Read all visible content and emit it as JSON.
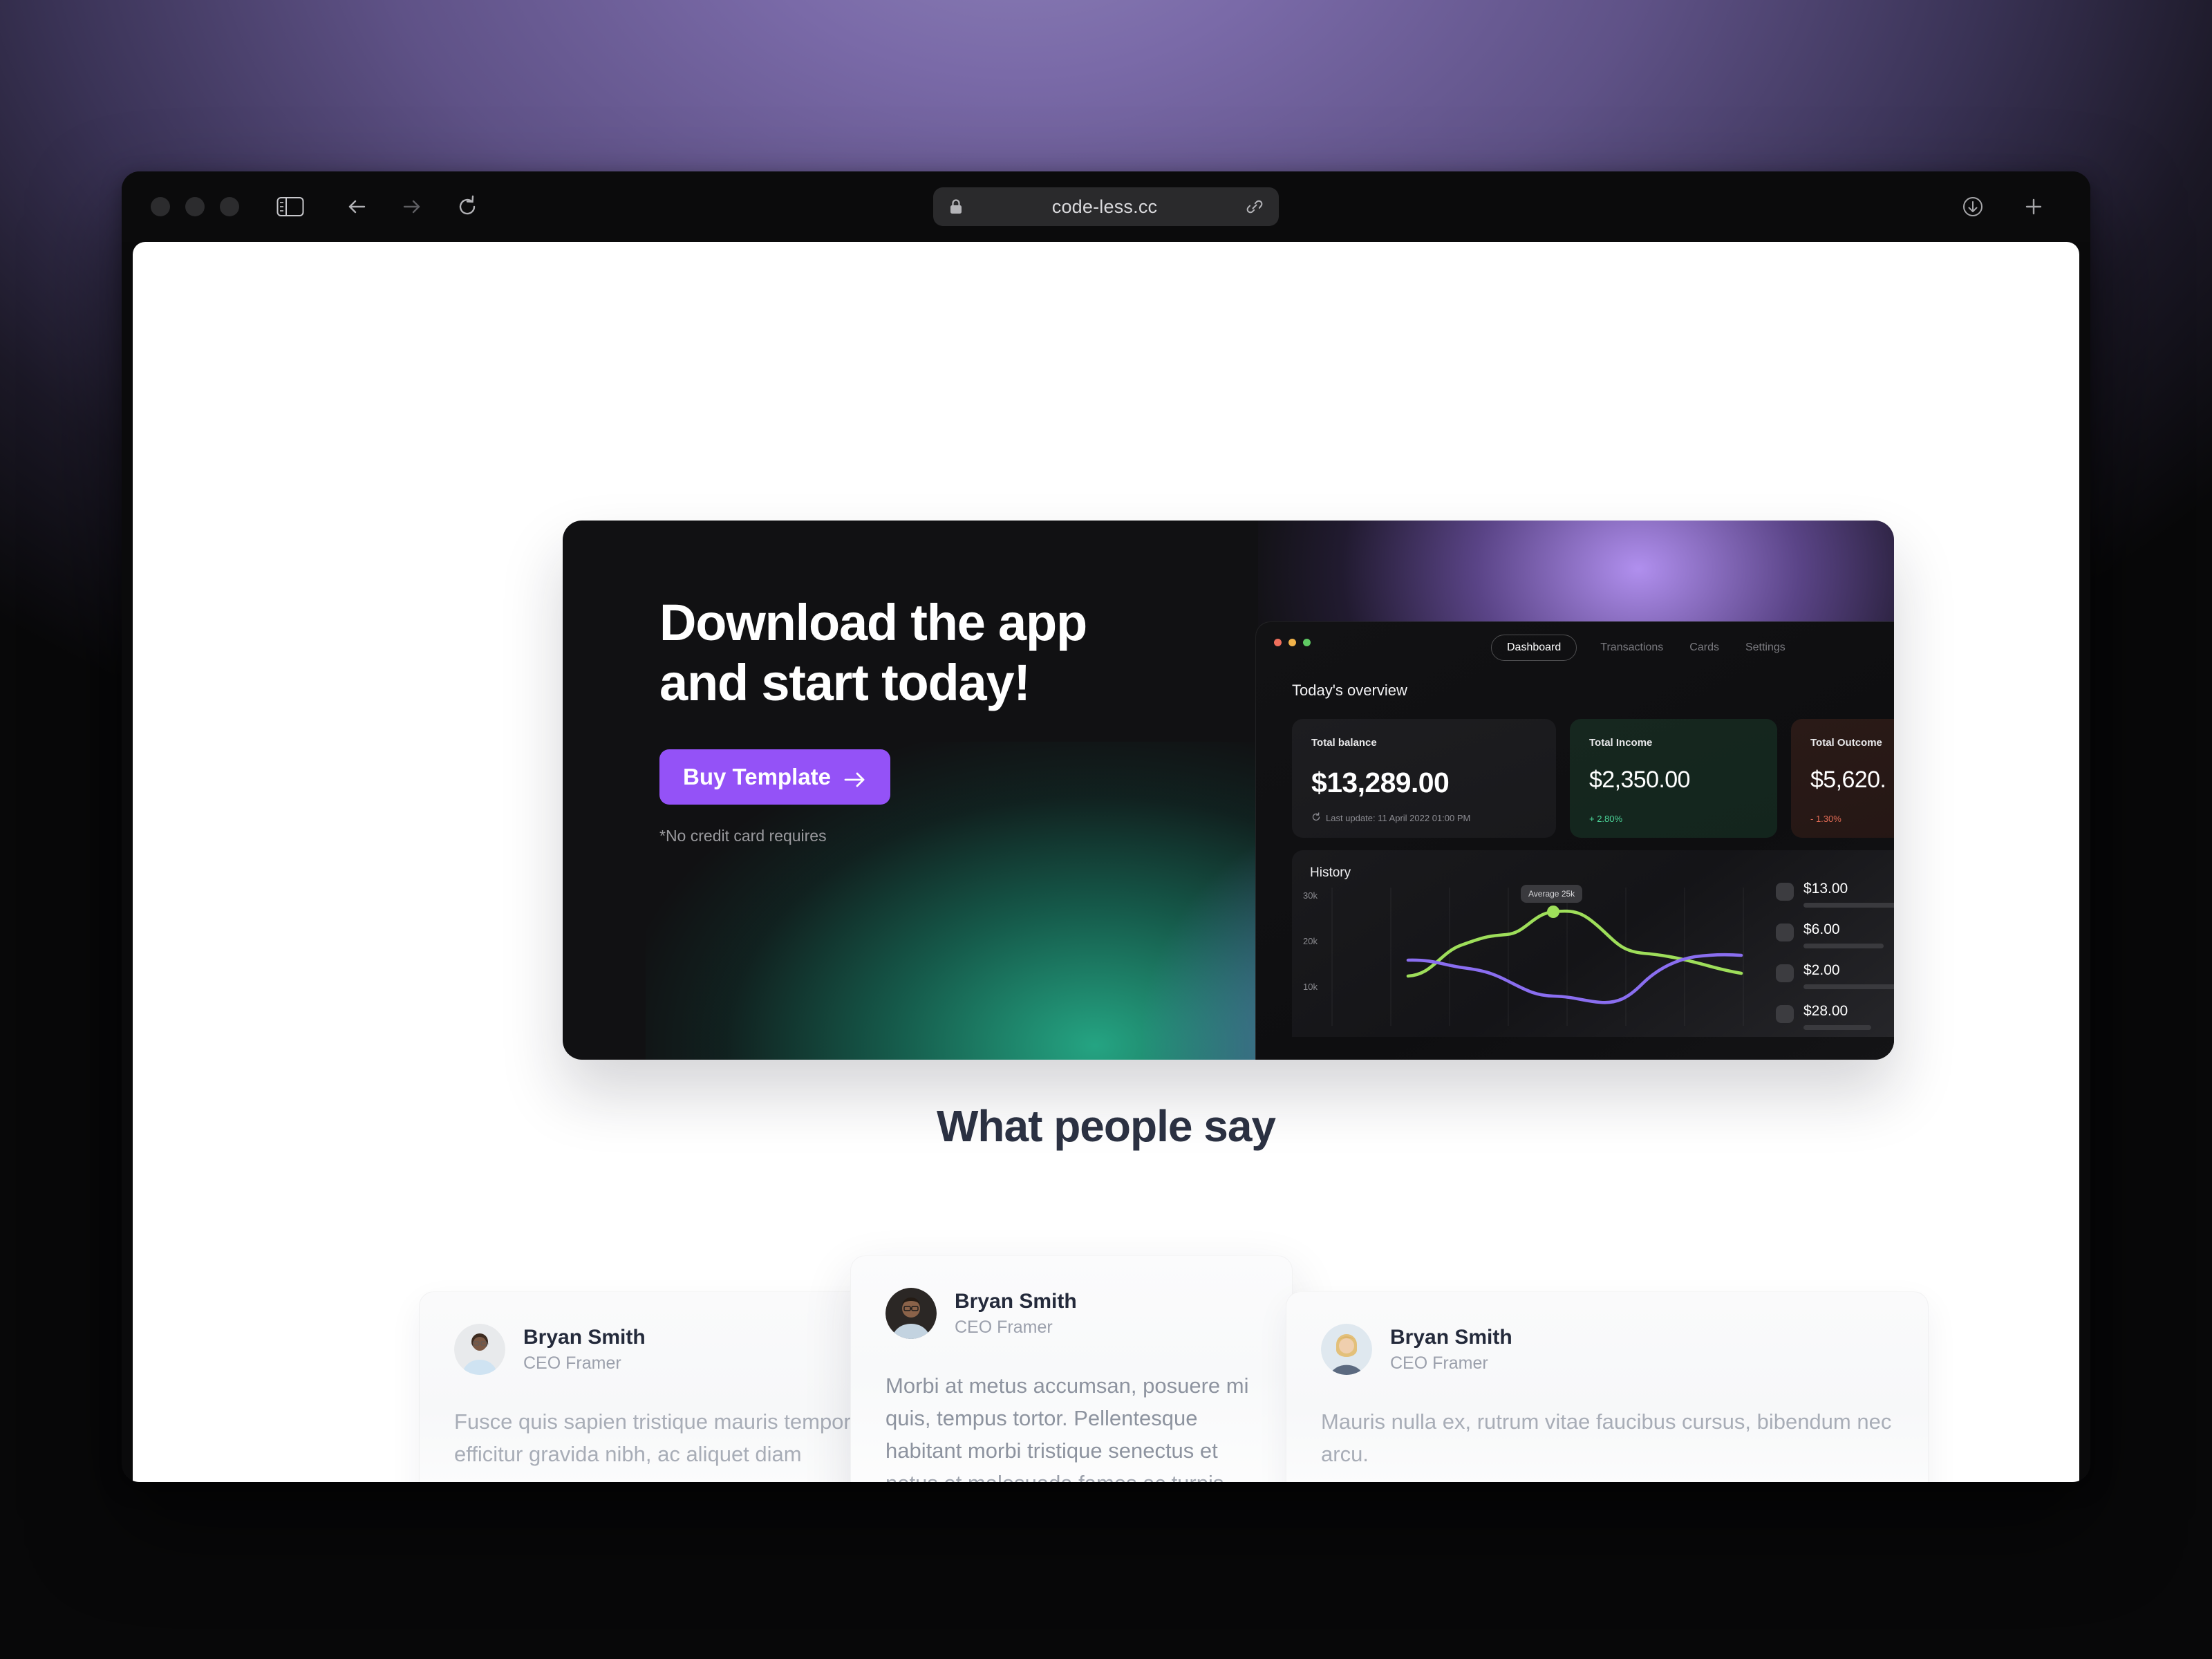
{
  "browser": {
    "url": "code-less.cc",
    "icons": {
      "sidebar": "sidebar-icon",
      "back": "back-arrow-icon",
      "forward": "forward-arrow-icon",
      "reload": "reload-icon",
      "lock": "lock-icon",
      "link": "link-icon",
      "downloads": "download-icon",
      "newtab": "plus-icon"
    }
  },
  "hero": {
    "title": "Download the app\nand start today!",
    "cta_label": "Buy Template",
    "note": "*No credit card requires",
    "cta_color": "#9452f7"
  },
  "dashboard": {
    "tabs": [
      {
        "label": "Dashboard",
        "active": true
      },
      {
        "label": "Transactions",
        "active": false
      },
      {
        "label": "Cards",
        "active": false
      },
      {
        "label": "Settings",
        "active": false
      }
    ],
    "overview_label": "Today's overview",
    "stats": [
      {
        "label": "Total balance",
        "value": "$13,289.00",
        "sub": "Last update: 11 April 2022 01:00 PM",
        "trend": "none"
      },
      {
        "label": "Total Income",
        "value": "$2,350.00",
        "sub": "+ 2.80%",
        "trend": "up"
      },
      {
        "label": "Total Outcome",
        "value": "$5,620.",
        "sub": "- 1.30%",
        "trend": "down"
      }
    ],
    "history": {
      "title": "History",
      "tooltip": "Average 25k",
      "yticks": [
        "30k",
        "20k",
        "10k"
      ]
    },
    "transactions": [
      {
        "amount": "$13.00",
        "bar": 58
      },
      {
        "amount": "$6.00",
        "bar": 46
      },
      {
        "amount": "$2.00",
        "bar": 76
      },
      {
        "amount": "$28.00",
        "bar": 38
      }
    ]
  },
  "chart_data": {
    "type": "line",
    "title": "History",
    "xlabel": "",
    "ylabel": "",
    "ylim": [
      5000,
      32000
    ],
    "yticks": [
      10000,
      20000,
      30000
    ],
    "ytick_labels": [
      "10k",
      "20k",
      "30k"
    ],
    "grid": true,
    "legend": "none",
    "annotations": [
      {
        "text": "Average 25k",
        "x": 5,
        "y": 25000,
        "series": "Income"
      }
    ],
    "x": [
      0,
      1,
      2,
      3,
      4,
      5,
      6,
      7,
      8,
      9
    ],
    "series": [
      {
        "name": "Income",
        "color": "#9ede5a",
        "values": [
          12500,
          14500,
          18500,
          20000,
          20300,
          25000,
          24500,
          18500,
          18000,
          15000
        ]
      },
      {
        "name": "Outcome",
        "color": "#8a6ef0",
        "values": [
          15500,
          15200,
          14200,
          13900,
          13700,
          11000,
          10800,
          8800,
          8700,
          13000
        ]
      }
    ]
  },
  "testimonials": {
    "section_title": "What people say",
    "cards": [
      {
        "name": "Bryan Smith",
        "role": "CEO Framer",
        "quote": "Fusce quis sapien tristique mauris tempor tristique. Donec efficitur gravida nibh, ac aliquet diam",
        "avatar": "avatar-man-dark-bg"
      },
      {
        "name": "Bryan Smith",
        "role": "CEO Framer",
        "quote": "Morbi at metus accumsan, posuere mi quis, tempus tortor. Pellentesque habitant morbi tristique senectus et netus et malesuada fames ac turpis egestas",
        "avatar": "avatar-man-glasses"
      },
      {
        "name": "Bryan Smith",
        "role": "CEO Framer",
        "quote": "Mauris nulla ex, rutrum vitae faucibus cursus, bibendum nec arcu.",
        "avatar": "avatar-woman-blonde"
      }
    ]
  }
}
